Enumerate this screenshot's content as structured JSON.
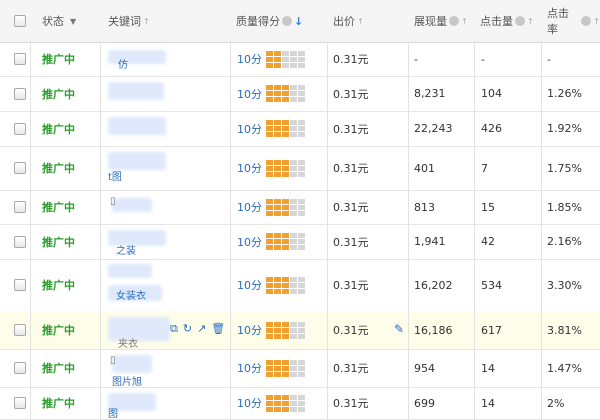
{
  "header": {
    "status": "状态",
    "keyword": "关键词",
    "quality": "质量得分",
    "bid": "出价",
    "impressions": "展现量",
    "clicks": "点击量",
    "ctr": "点击率"
  },
  "rows": [
    {
      "status": "推广中",
      "kw": "仿",
      "score": "10分",
      "bars": 6,
      "bid": "0.31元",
      "impressions": "-",
      "clicks": "-",
      "ctr": "-"
    },
    {
      "status": "推广中",
      "kw": "",
      "score": "10分",
      "bars": 8,
      "bid": "0.31元",
      "impressions": "8,231",
      "clicks": "104",
      "ctr": "1.26%"
    },
    {
      "status": "推广中",
      "kw": "",
      "score": "10分",
      "bars": 8,
      "bid": "0.31元",
      "impressions": "22,243",
      "clicks": "426",
      "ctr": "1.92%"
    },
    {
      "status": "推广中",
      "kw": "t图",
      "score": "10分",
      "bars": 9,
      "bid": "0.31元",
      "impressions": "401",
      "clicks": "7",
      "ctr": "1.75%"
    },
    {
      "status": "推广中",
      "kw": "",
      "score": "10分",
      "bars": 9,
      "bid": "0.31元",
      "impressions": "813",
      "clicks": "15",
      "ctr": "1.85%"
    },
    {
      "status": "推广中",
      "kw": "之装",
      "score": "10分",
      "bars": 8,
      "bid": "0.31元",
      "impressions": "1,941",
      "clicks": "42",
      "ctr": "2.16%"
    },
    {
      "status": "推广中",
      "kw": "女装衣",
      "score": "10分",
      "bars": 8,
      "bid": "0.31元",
      "impressions": "16,202",
      "clicks": "534",
      "ctr": "3.30%"
    },
    {
      "status": "推广中",
      "kw": "夹衣",
      "score": "10分",
      "bars": 8,
      "bid": "0.31元",
      "impressions": "16,186",
      "clicks": "617",
      "ctr": "3.81%"
    },
    {
      "status": "推广中",
      "kw": "图片旭",
      "score": "10分",
      "bars": 9,
      "bid": "0.31元",
      "impressions": "954",
      "clicks": "14",
      "ctr": "1.47%"
    },
    {
      "status": "推广中",
      "kw": "图",
      "score": "10分",
      "bars": 8,
      "bid": "0.31元",
      "impressions": "699",
      "clicks": "14",
      "ctr": "2%"
    }
  ],
  "colors": {
    "status_green": "#2b9d2b",
    "link_blue": "#2a6cc2",
    "bar_orange": "#f0a030",
    "bar_gray": "#d6d6d6",
    "highlight_row": "#fdfde9"
  }
}
